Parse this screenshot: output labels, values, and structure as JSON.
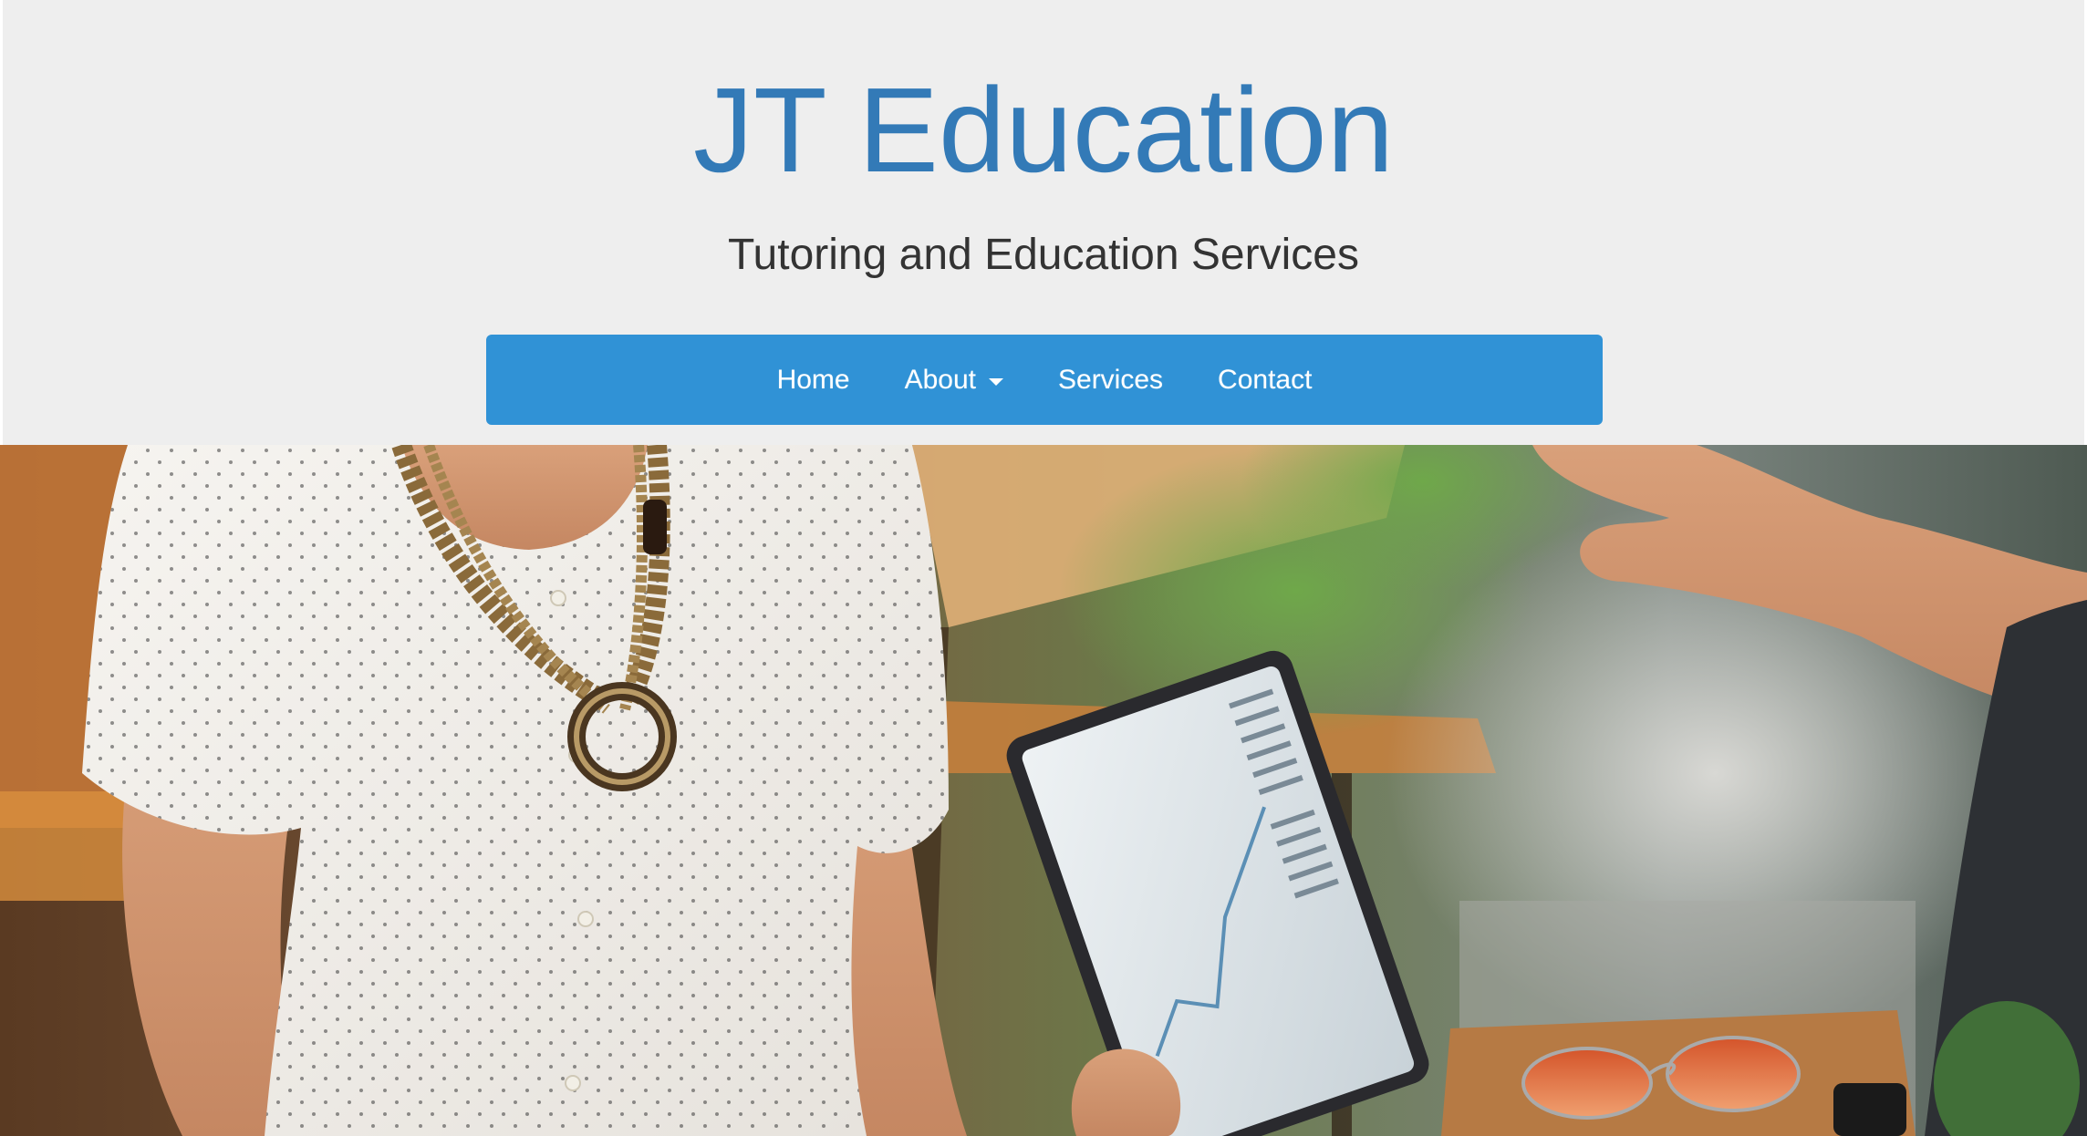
{
  "header": {
    "title": "JT Education",
    "tagline": "Tutoring and Education Services"
  },
  "nav": {
    "items": [
      {
        "label": "Home",
        "has_dropdown": false
      },
      {
        "label": "About",
        "has_dropdown": true
      },
      {
        "label": "Services",
        "has_dropdown": false
      },
      {
        "label": "Contact",
        "has_dropdown": false
      }
    ]
  },
  "hero": {
    "image": "photo-woman-with-tablet-at-outdoor-table"
  },
  "colors": {
    "header_bg": "#eeeeee",
    "title": "#337ab7",
    "navbar": "#3092d6",
    "nav_text": "#ffffff"
  }
}
